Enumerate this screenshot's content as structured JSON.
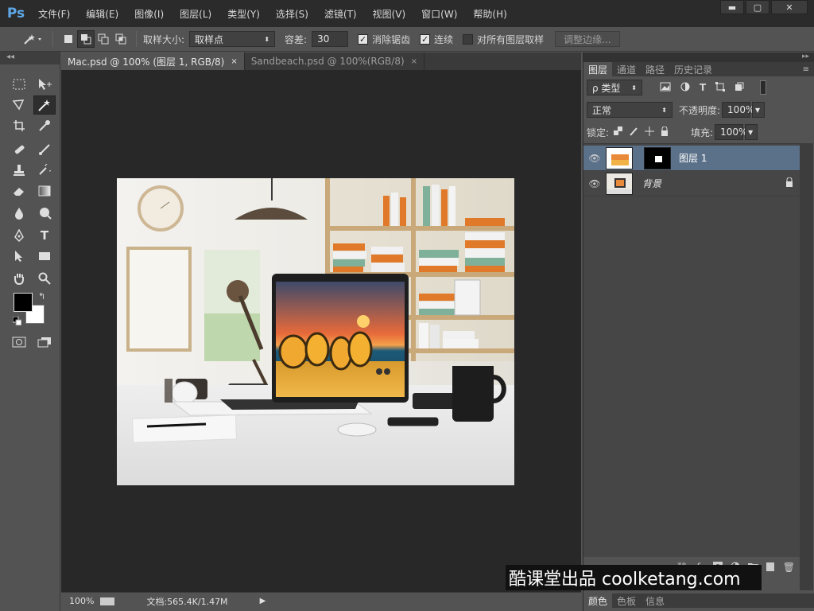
{
  "app": {
    "logo": "Ps"
  },
  "menu": [
    "文件(F)",
    "编辑(E)",
    "图像(I)",
    "图层(L)",
    "类型(Y)",
    "选择(S)",
    "滤镜(T)",
    "视图(V)",
    "窗口(W)",
    "帮助(H)"
  ],
  "window_controls": {
    "minimize": "▬",
    "maximize": "▢",
    "close": "✕"
  },
  "options": {
    "sample_size_label": "取样大小:",
    "sample_size_value": "取样点",
    "tolerance_label": "容差:",
    "tolerance_value": "30",
    "antialias_label": "消除锯齿",
    "antialias_checked": true,
    "contiguous_label": "连续",
    "contiguous_checked": true,
    "sample_all_label": "对所有图层取样",
    "sample_all_checked": false,
    "refine_edge_label": "调整边缘..."
  },
  "doc_tabs": [
    {
      "label": "Mac.psd @ 100% (图层 1, RGB/8)",
      "close": "×",
      "active": true
    },
    {
      "label": "Sandbeach.psd @ 100%(RGB/8)",
      "close": "×",
      "active": false
    }
  ],
  "toolbox": {
    "collapse": "◂◂"
  },
  "status": {
    "zoom": "100%",
    "doc_info": "文档:565.4K/1.47M",
    "arrow": "▶"
  },
  "panel": {
    "tabs": [
      "图层",
      "通道",
      "路径",
      "历史记录"
    ],
    "kind_label": "ρ 类型",
    "blend_mode": "正常",
    "opacity_label": "不透明度:",
    "opacity_value": "100%",
    "lock_label": "锁定:",
    "fill_label": "填充:",
    "fill_value": "100%",
    "layers": [
      {
        "name": "图层 1",
        "selected": true
      },
      {
        "name": "背景",
        "selected": false
      }
    ],
    "bottom_tabs": [
      "颜色",
      "色板",
      "信息"
    ]
  },
  "watermark": "酷课堂出品 coolketang.com",
  "colors": {
    "accent": "#5fa8e8",
    "selected_layer": "#5b7189",
    "canvas_bg": "#282828"
  }
}
